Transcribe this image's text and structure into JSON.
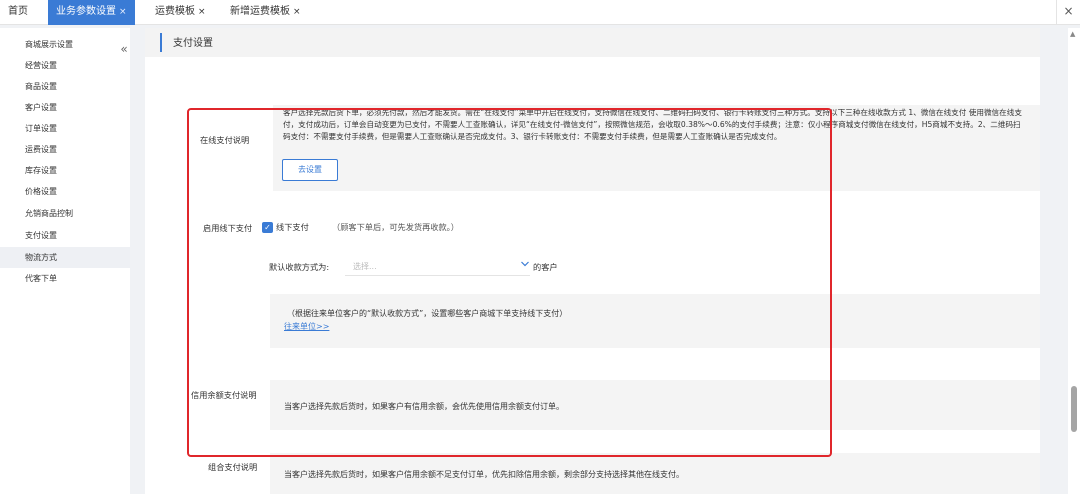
{
  "tabs": [
    {
      "label": "首页",
      "closable": false,
      "active": false
    },
    {
      "label": "业务参数设置",
      "closable": true,
      "active": true
    },
    {
      "label": "运费模板",
      "closable": true,
      "active": false
    },
    {
      "label": "新增运费模板",
      "closable": true,
      "active": false
    }
  ],
  "tab_close_glyph": "×",
  "window_close": "×",
  "sidebar": {
    "collapse_icon": "«",
    "items": [
      {
        "label": "商城展示设置"
      },
      {
        "label": "经营设置"
      },
      {
        "label": "商品设置"
      },
      {
        "label": "客户设置"
      },
      {
        "label": "订单设置"
      },
      {
        "label": "运费设置"
      },
      {
        "label": "库存设置"
      },
      {
        "label": "价格设置"
      },
      {
        "label": "允销商品控制"
      },
      {
        "label": "支付设置"
      },
      {
        "label": "物流方式",
        "active": true
      },
      {
        "label": "代客下单"
      }
    ]
  },
  "section": {
    "title": "支付设置"
  },
  "online_pay": {
    "label": "在线支付说明",
    "description": "客户选择先款后货下单，必须先付款，然后才能发货。需在“在线支付”菜单中开启在线支付，支持微信在线支付、二维码扫码支付、银行卡转账支付三种方式。支持以下三种在线收款方式 1、微信在线支付 使用微信在线支付，支付成功后，订单会自动变更为已支付，不需要人工查账确认，详见“在线支付-微信支付”，按照微信规范，会收取0.38%～0.6%的支付手续费；注意：仅小程序商城支付微信在线支付，H5商城不支持。2、二维码扫码支付：不需要支付手续费，但是需要人工查账确认是否完成支付。3、银行卡转账支付：不需要支付手续费，但是需要人工查账确认是否完成支付。",
    "button": "去设置"
  },
  "offline_pay": {
    "label": "启用线下支付",
    "checkbox_label": "线下支付",
    "checked": true,
    "note": "（顾客下单后，可先发货再收款。）",
    "default_method_label": "默认收款方式为:",
    "select_placeholder": "选择...",
    "select_suffix": "的客户",
    "info_text": "（根据往来单位客户的“默认收款方式”，设置哪些客户商城下单支持线下支付）",
    "info_link": "往来单位>>"
  },
  "credit_pay": {
    "label": "信用余额支付说明",
    "text": "当客户选择先款后货时，如果客户有信用余额，会优先使用信用余额支付订单。"
  },
  "combo_pay": {
    "label": "组合支付说明",
    "text": "当客户选择先款后货时，如果客户信用余额不足支付订单，优先扣除信用余额，剩余部分支持选择其他在线支付。"
  },
  "colors": {
    "accent": "#3a7bd5",
    "highlight": "#e0262b"
  }
}
